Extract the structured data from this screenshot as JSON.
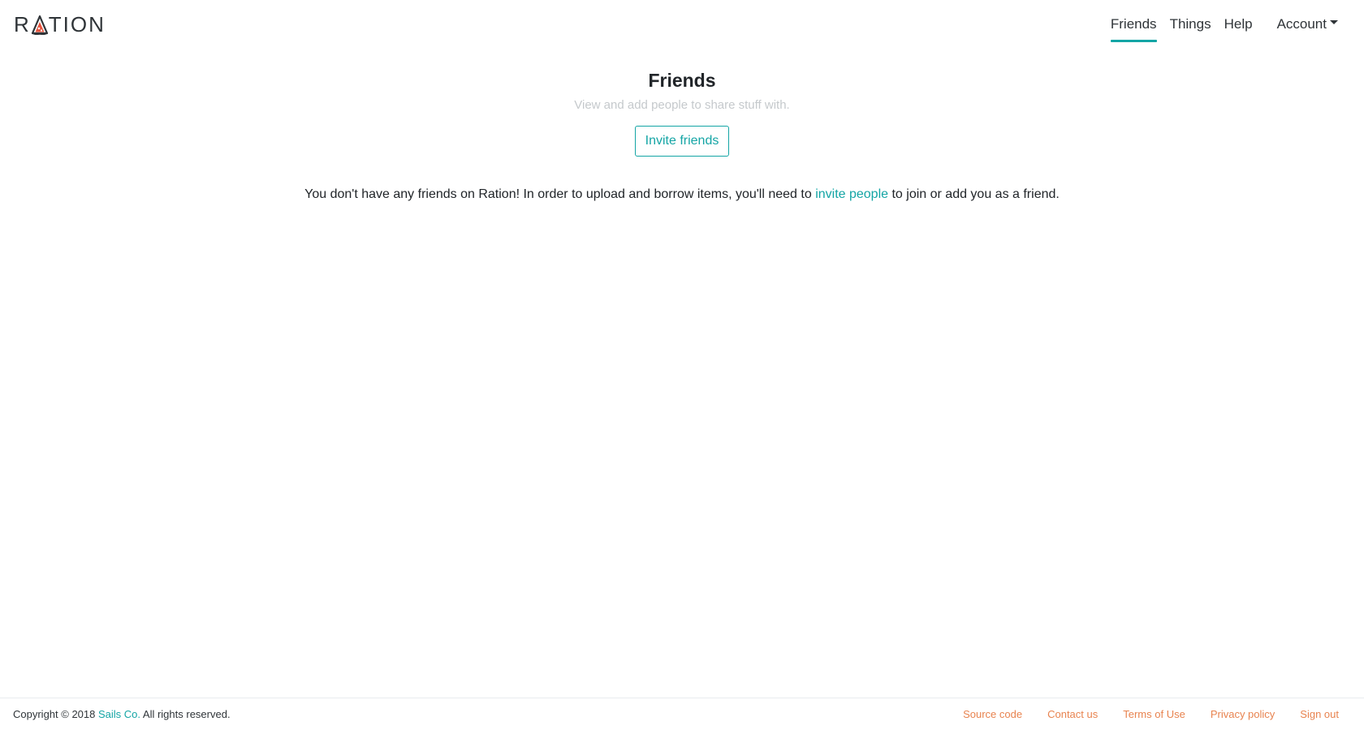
{
  "header": {
    "logo": {
      "prefix": "R",
      "suffix": "TION",
      "accent_color": "#e5533d"
    },
    "nav": {
      "friends": "Friends",
      "things": "Things",
      "help": "Help",
      "account": "Account"
    }
  },
  "main": {
    "title": "Friends",
    "subtitle": "View and add people to share stuff with.",
    "invite_button": "Invite friends",
    "empty_message": {
      "before": "You don't have any friends on Ration! In order to upload and borrow items, you'll need to ",
      "link": "invite people",
      "after": " to join or add you as a friend."
    }
  },
  "footer": {
    "copyright_prefix": "Copyright © 2018 ",
    "company": "Sails Co.",
    "copyright_suffix": " All rights reserved.",
    "links": {
      "source_code": "Source code",
      "contact_us": "Contact us",
      "terms": "Terms of Use",
      "privacy": "Privacy policy",
      "sign_out": "Sign out"
    }
  },
  "colors": {
    "accent": "#14a5a5",
    "footer_link": "#e8834f",
    "subtitle": "#c5c9cc"
  }
}
